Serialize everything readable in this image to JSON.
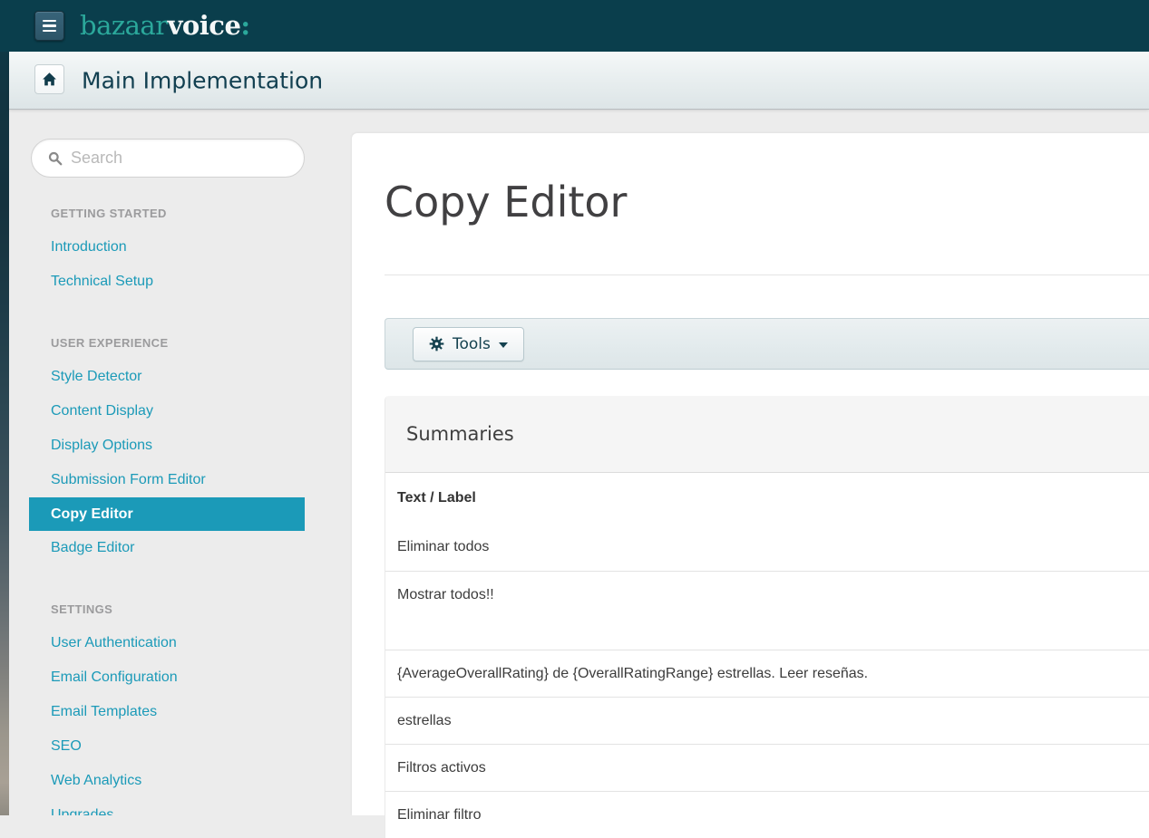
{
  "brand": {
    "logo_first": "bazaar",
    "logo_second": "voice",
    "logo_colon": ":"
  },
  "header": {
    "title": "Main Implementation"
  },
  "sidebar": {
    "search_placeholder": "Search",
    "sections": [
      {
        "label": "GETTING STARTED",
        "items": [
          {
            "label": "Introduction",
            "selected": false
          },
          {
            "label": "Technical Setup",
            "selected": false
          }
        ]
      },
      {
        "label": "USER EXPERIENCE",
        "items": [
          {
            "label": "Style Detector",
            "selected": false
          },
          {
            "label": "Content Display",
            "selected": false
          },
          {
            "label": "Display Options",
            "selected": false
          },
          {
            "label": "Submission Form Editor",
            "selected": false
          },
          {
            "label": "Copy Editor",
            "selected": true
          },
          {
            "label": "Badge Editor",
            "selected": false
          }
        ]
      },
      {
        "label": "SETTINGS",
        "items": [
          {
            "label": "User Authentication",
            "selected": false
          },
          {
            "label": "Email Configuration",
            "selected": false
          },
          {
            "label": "Email Templates",
            "selected": false
          },
          {
            "label": "SEO",
            "selected": false
          },
          {
            "label": "Web Analytics",
            "selected": false
          },
          {
            "label": "Upgrades",
            "selected": false
          }
        ]
      }
    ]
  },
  "main": {
    "page_title": "Copy Editor",
    "toolbar": {
      "tools_label": "Tools"
    },
    "panel": {
      "title": "Summaries",
      "table": {
        "header": "Text / Label",
        "rows": [
          {
            "text": "Eliminar todos",
            "tall": false
          },
          {
            "text": "Mostrar todos!!",
            "tall": true
          },
          {
            "text": "{AverageOverallRating} de {OverallRatingRange} estrellas. Leer reseñas.",
            "tall": false
          },
          {
            "text": "estrellas",
            "tall": false
          },
          {
            "text": "Filtros activos",
            "tall": false
          },
          {
            "text": "Eliminar filtro",
            "tall": false
          }
        ]
      }
    }
  },
  "colors": {
    "header_bg": "#0a3e4c",
    "accent": "#1b9ab8",
    "logo_teal": "#2ba89b",
    "selected_item_bg": "#1b9ab8",
    "selected_item_text": "#ffffff",
    "toolbar_bg": "#e3ebed",
    "panel_header_bg": "#f5f5f5"
  }
}
